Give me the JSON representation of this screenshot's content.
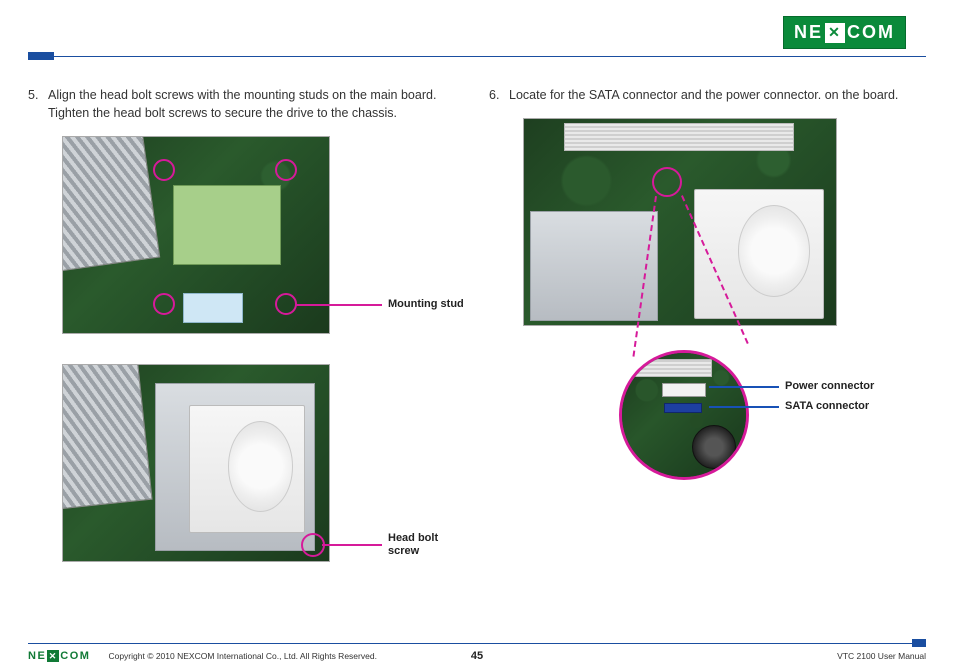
{
  "brand": {
    "left": "NE",
    "mid_glyph": "✕",
    "right": "COM"
  },
  "steps": {
    "s5": {
      "num": "5.",
      "text": "Align the head bolt screws with the mounting studs on the main board. Tighten the head bolt screws to secure the drive to the chassis."
    },
    "s6": {
      "num": "6.",
      "text": "Locate for the SATA connector and the power connector. on the board."
    }
  },
  "callouts": {
    "mounting_stud": "Mounting stud",
    "head_bolt_screw": "Head bolt screw",
    "power_connector": "Power connector",
    "sata_connector": "SATA connector"
  },
  "footer": {
    "copyright": "Copyright © 2010 NEXCOM International Co., Ltd. All Rights Reserved.",
    "page_number": "45",
    "manual_title": "VTC 2100 User Manual"
  }
}
